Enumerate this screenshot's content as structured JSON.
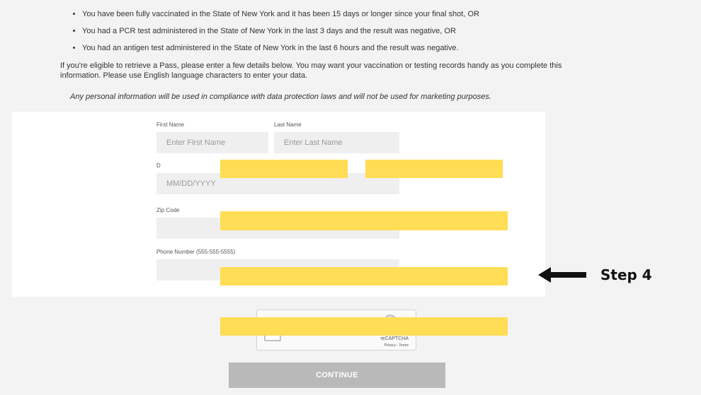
{
  "eligibility": {
    "bullets": [
      "You have been fully vaccinated in the State of New York and it has been 15 days or longer since your final shot, OR",
      "You had a PCR test administered in the State of New York in the last 3 days and the result was negative, OR",
      "You had an antigen test administered in the State of New York in the last 6 hours and the result was negative."
    ],
    "intro": "If you're eligible to retrieve a Pass, please enter a few details below. You may want your vaccination or testing records handy as you complete this information. Please use English language characters to enter your data.",
    "disclaimer": "Any personal information will be used in compliance with data protection laws and will not be used for marketing purposes."
  },
  "form": {
    "first_name": {
      "label": "First Name",
      "placeholder": "Enter First Name",
      "value": ""
    },
    "last_name": {
      "label": "Last Name",
      "placeholder": "Enter Last Name",
      "value": ""
    },
    "dob": {
      "label": "D",
      "placeholder": "MM/DD/YYYY",
      "value": ""
    },
    "zip": {
      "label": "Zip Code",
      "placeholder": "",
      "value": ""
    },
    "phone": {
      "label": "Phone Number (555-555-5555)",
      "placeholder": "",
      "value": ""
    }
  },
  "captcha": {
    "brand": "reCAPTCHA",
    "links": "Privacy - Terms"
  },
  "continue_label": "CONTINUE",
  "annotation": {
    "label": "Step 4"
  },
  "colors": {
    "redaction": "#ffdd55",
    "button": "#b9b9b9",
    "background": "#f3f3f3"
  }
}
